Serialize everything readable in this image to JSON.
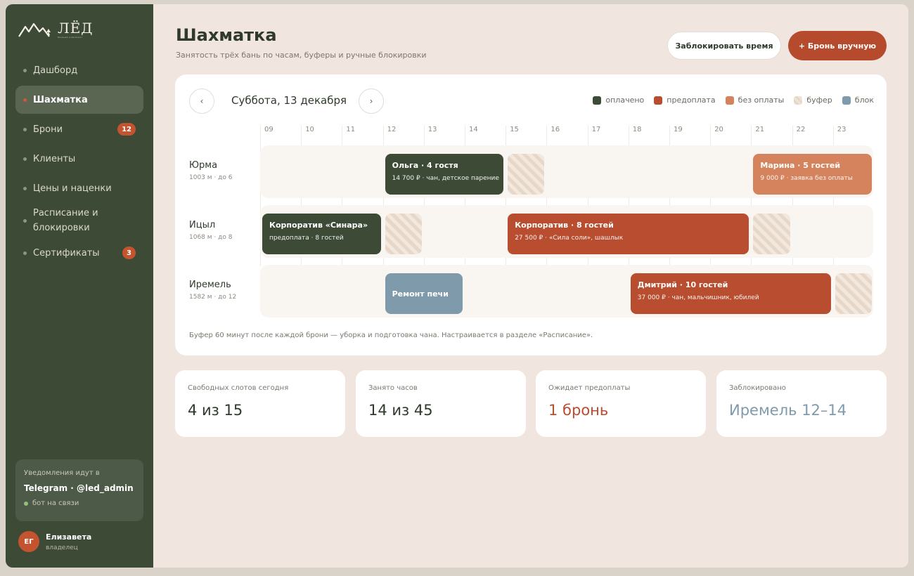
{
  "brand": {
    "name": "ЛЁД",
    "tagline": "банный комплекс"
  },
  "nav": [
    {
      "label": "Дашборд"
    },
    {
      "label": "Шахматка"
    },
    {
      "label": "Брони",
      "badge": "12"
    },
    {
      "label": "Клиенты"
    },
    {
      "label": "Цены и наценки"
    },
    {
      "label": "Расписание и блокировки"
    },
    {
      "label": "Сертификаты",
      "badge": "3"
    }
  ],
  "notify": {
    "label": "Уведомления идут в",
    "value": "Telegram · @led_admin",
    "status": "бот на связи"
  },
  "user": {
    "initials": "ЕГ",
    "name": "Елизавета",
    "role": "владелец"
  },
  "header": {
    "title": "Шахматка",
    "subtitle": "Занятость трёх бань по часам, буферы и ручные блокировки",
    "block_button": "Заблокировать время",
    "book_button": "+ Бронь вручную"
  },
  "schedule": {
    "date": "Суббота, 13 декабря",
    "prev_icon": "‹",
    "next_icon": "›",
    "legend": [
      {
        "label": "оплачено",
        "color": "#3c4a36"
      },
      {
        "label": "предоплата",
        "color": "#b94d2f"
      },
      {
        "label": "без оплаты",
        "color": "#d4835d"
      },
      {
        "label": "буфер",
        "color": "hatch"
      },
      {
        "label": "блок",
        "color": "#7f9bab"
      }
    ],
    "hours": [
      "09",
      "10",
      "11",
      "12",
      "13",
      "14",
      "15",
      "16",
      "17",
      "18",
      "19",
      "20",
      "21",
      "22",
      "23"
    ],
    "rows": [
      {
        "name": "Юрма",
        "meta": "1003 м · до 6",
        "bookings": [
          {
            "title": "Ольга · 4 гостя",
            "sub": "14 700 ₽ · чан, детское парение",
            "status": "paid",
            "start": 12,
            "end": 15
          },
          {
            "title": "Марина · 5 гостей",
            "sub": "9 000 ₽ · заявка без оплаты",
            "status": "unpaid",
            "start": 21,
            "end": 24
          }
        ],
        "buffers": [
          {
            "start": 15,
            "end": 16
          }
        ]
      },
      {
        "name": "Ицыл",
        "meta": "1068 м · до 8",
        "bookings": [
          {
            "title": "Корпоратив «Синара»",
            "sub": "предоплата · 8 гостей",
            "status": "paid",
            "start": 9,
            "end": 12
          },
          {
            "title": "Корпоратив · 8 гостей",
            "sub": "27 500 ₽ · «Сила соли», шашлык",
            "status": "prepaid",
            "start": 15,
            "end": 21
          }
        ],
        "buffers": [
          {
            "start": 12,
            "end": 13
          },
          {
            "start": 21,
            "end": 22
          }
        ]
      },
      {
        "name": "Иремель",
        "meta": "1582 м · до 12",
        "bookings": [
          {
            "title": "Ремонт печи",
            "sub": "",
            "status": "blocked",
            "start": 12,
            "end": 14
          },
          {
            "title": "Дмитрий · 10 гостей",
            "sub": "37 000 ₽ · чан, мальчишник, юбилей",
            "status": "prepaid",
            "start": 18,
            "end": 23
          }
        ],
        "buffers": [
          {
            "start": 23,
            "end": 24
          }
        ]
      }
    ],
    "hint": "Буфер 60 минут после каждой брони — уборка и подготовка чана. Настраивается в разделе «Расписание»."
  },
  "stats": [
    {
      "label": "Свободных слотов сегодня",
      "value": "4 из 15",
      "color": "#2f3a2c"
    },
    {
      "label": "Занято часов",
      "value": "14 из 45",
      "color": "#2f3a2c"
    },
    {
      "label": "Ожидает предоплаты",
      "value": "1 бронь",
      "color": "#b94d2f"
    },
    {
      "label": "Заблокировано",
      "value": "Иремель 12–14",
      "color": "#7f9bab"
    }
  ]
}
